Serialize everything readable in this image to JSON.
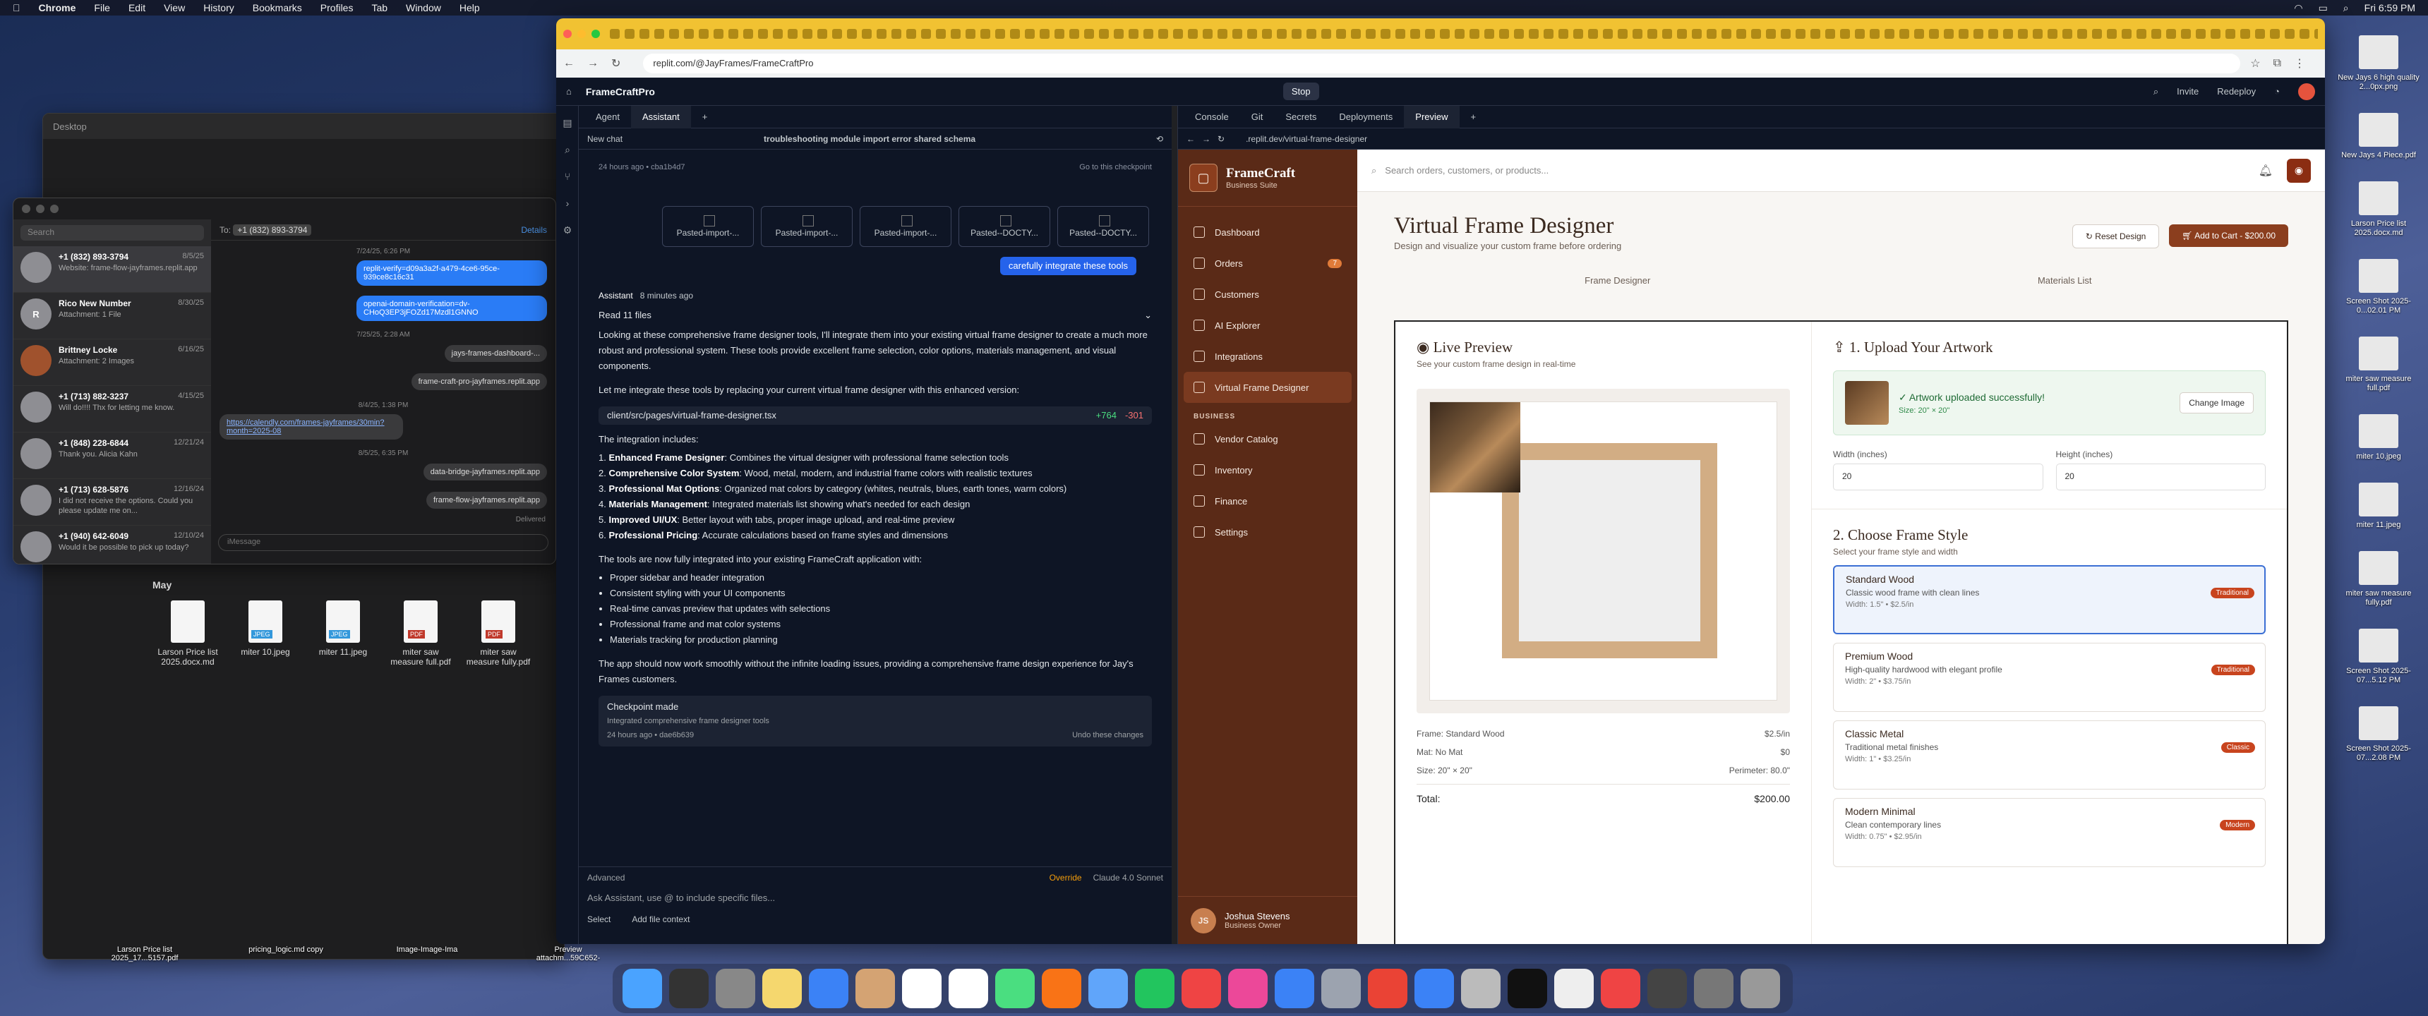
{
  "menubar": {
    "apple": "",
    "app": "Chrome",
    "items": [
      "File",
      "Edit",
      "View",
      "History",
      "Bookmarks",
      "Profiles",
      "Tab",
      "Window",
      "Help"
    ],
    "clock": "Fri 6:59 PM"
  },
  "finder": {
    "title": "Desktop",
    "month": "May",
    "files": [
      {
        "name": "Larson Price list 2025.docx.md",
        "type": "doc"
      },
      {
        "name": "miter 10.jpeg",
        "type": "jpg"
      },
      {
        "name": "miter 11.jpeg",
        "type": "jpg"
      },
      {
        "name": "miter saw measure full.pdf",
        "type": "pdf"
      },
      {
        "name": "miter saw measure fully.pdf",
        "type": "pdf"
      }
    ]
  },
  "messages": {
    "search_placeholder": "Search",
    "to_label": "To:",
    "to_value": "+1 (832) 893-3794",
    "details": "Details",
    "conversations": [
      {
        "name": "+1 (832) 893-3794",
        "date": "8/5/25",
        "preview": "Website: frame-flow-jayframes.replit.app",
        "initial": ""
      },
      {
        "name": "Rico New Number",
        "date": "8/30/25",
        "preview": "Attachment: 1 File",
        "initial": "R"
      },
      {
        "name": "Brittney Locke",
        "date": "6/16/25",
        "preview": "Attachment: 2 Images",
        "initial": ""
      },
      {
        "name": "+1 (713) 882-3237",
        "date": "4/15/25",
        "preview": "Will do!!!! Thx for letting me know.",
        "initial": ""
      },
      {
        "name": "+1 (848) 228-6844",
        "date": "12/21/24",
        "preview": "Thank you. Alicia Kahn",
        "initial": ""
      },
      {
        "name": "+1 (713) 628-5876",
        "date": "12/16/24",
        "preview": "I did not receive the options. Could you please update me on...",
        "initial": ""
      },
      {
        "name": "+1 (940) 642-6049",
        "date": "12/10/24",
        "preview": "Would it be possible to pick up today?",
        "initial": ""
      }
    ],
    "thread": {
      "ts1": "7/24/25, 6:26 PM",
      "b1": "replit-verify=d09a3a2f-a479-4ce6-95ce-939ce8c16c31",
      "b2": "openai-domain-verification=dv-CHoQ3EP3jFOZd17Mzdl1GNNO",
      "ts2": "7/25/25, 2:28 AM",
      "b3": "jays-frames-dashboard-...",
      "b4": "frame-craft-pro-jayframes.replit.app",
      "ts3": "8/4/25, 1:38 PM",
      "b5": "https://calendly.com/frames-jayframes/30min?month=2025-08",
      "ts4": "8/5/25, 6:35 PM",
      "b6": "data-bridge-jayframes.replit.app",
      "b7": "frame-flow-jayframes.replit.app",
      "delivered": "Delivered",
      "input_placeholder": "iMessage"
    }
  },
  "browser": {
    "url": "replit.com/@JayFrames/FrameCraftPro"
  },
  "replit": {
    "project": "FrameCraftPro",
    "stop": "Stop",
    "invite": "Invite",
    "redeploy": "Redeploy",
    "left_tabs": [
      "Agent",
      "Assistant"
    ],
    "right_tabs": [
      "Console",
      "Git",
      "Secrets",
      "Deployments",
      "Preview"
    ],
    "new_chat": "New chat",
    "chat_title": "troubleshooting module import error shared schema",
    "checkpoint_meta": "24 hours ago  •  cba1b4d7",
    "go_checkpoint": "Go to this checkpoint",
    "attachments": [
      "Pasted-import-...",
      "Pasted-import-...",
      "Pasted-import-...",
      "Pasted--DOCTY...",
      "Pasted--DOCTY..."
    ],
    "user_message": "carefully integrate these tools",
    "assistant_name": "Assistant",
    "assistant_time": "8 minutes ago",
    "read_files": "Read 11 files",
    "p1": "Looking at these comprehensive frame designer tools, I'll integrate them into your existing virtual frame designer to create a much more robust and professional system. These tools provide excellent frame selection, color options, materials management, and visual components.",
    "p2": "Let me integrate these tools by replacing your current virtual frame designer with this enhanced version:",
    "file_path": "client/src/pages/virtual-frame-designer.tsx",
    "file_add": "+764",
    "file_del": "-301",
    "p3": "The integration includes:",
    "integration": [
      {
        "n": "1.",
        "b": "Enhanced Frame Designer",
        "t": ": Combines the virtual designer with professional frame selection tools"
      },
      {
        "n": "2.",
        "b": "Comprehensive Color System",
        "t": ": Wood, metal, modern, and industrial frame colors with realistic textures"
      },
      {
        "n": "3.",
        "b": "Professional Mat Options",
        "t": ": Organized mat colors by category (whites, neutrals, blues, earth tones, warm colors)"
      },
      {
        "n": "4.",
        "b": "Materials Management",
        "t": ": Integrated materials list showing what's needed for each design"
      },
      {
        "n": "5.",
        "b": "Improved UI/UX",
        "t": ": Better layout with tabs, proper image upload, and real-time preview"
      },
      {
        "n": "6.",
        "b": "Professional Pricing",
        "t": ": Accurate calculations based on frame styles and dimensions"
      }
    ],
    "p4": "The tools are now fully integrated into your existing FrameCraft application with:",
    "features": [
      "Proper sidebar and header integration",
      "Consistent styling with your UI components",
      "Real-time canvas preview that updates with selections",
      "Professional frame and mat color systems",
      "Materials tracking for production planning"
    ],
    "p5": "The app should now work smoothly without the infinite loading issues, providing a comprehensive frame design experience for Jay's Frames customers.",
    "checkpoint_title": "Checkpoint made",
    "checkpoint_desc": "Integrated comprehensive frame designer tools",
    "checkpoint_meta2": "24 hours ago  •  dae6b639",
    "undo": "Undo these changes",
    "advanced": "Advanced",
    "override": "Override",
    "model": "Claude 4.0 Sonnet",
    "ask_placeholder": "Ask Assistant, use @ to include specific files...",
    "select": "Select",
    "add_context": "Add file context",
    "preview_url": ".replit.dev/virtual-frame-designer"
  },
  "app": {
    "brand": "FrameCraft",
    "brand_sub": "Business Suite",
    "search_placeholder": "Search orders, customers, or products...",
    "nav": [
      {
        "label": "Dashboard"
      },
      {
        "label": "Orders",
        "badge": "7"
      },
      {
        "label": "Customers"
      },
      {
        "label": "AI Explorer"
      },
      {
        "label": "Integrations"
      },
      {
        "label": "Virtual Frame Designer"
      }
    ],
    "business_label": "BUSINESS",
    "business_nav": [
      "Vendor Catalog",
      "Inventory",
      "Finance",
      "Settings"
    ],
    "user_initials": "JS",
    "user_name": "Joshua Stevens",
    "user_role": "Business Owner",
    "page_title": "Virtual Frame Designer",
    "page_sub": "Design and visualize your custom frame before ordering",
    "reset": "Reset Design",
    "add_cart": "Add to Cart - $200.00",
    "tabs": [
      "Frame Designer",
      "Materials List"
    ],
    "preview_title": "Live Preview",
    "preview_sub": "See your custom frame design in real-time",
    "specs": {
      "frame_label": "Frame: Standard Wood",
      "frame_price": "$2.5/in",
      "mat_label": "Mat: No Mat",
      "mat_price": "$0",
      "size_label": "Size: 20\" × 20\"",
      "perimeter": "Perimeter: 80.0\"",
      "total_label": "Total:",
      "total": "$200.00"
    },
    "upload_title": "1. Upload Your Artwork",
    "upload_ok": "✓ Artwork uploaded successfully!",
    "upload_size": "Size: 20\" × 20\"",
    "change_image": "Change Image",
    "width_label": "Width (inches)",
    "width_value": "20",
    "height_label": "Height (inches)",
    "height_value": "20",
    "style_title": "2. Choose Frame Style",
    "style_sub": "Select your frame style and width",
    "styles": [
      {
        "name": "Standard Wood",
        "desc": "Classic wood frame with clean lines",
        "width": "Width: 1.5\" • $2.5/in",
        "tag": "Traditional"
      },
      {
        "name": "Premium Wood",
        "desc": "High-quality hardwood with elegant profile",
        "width": "Width: 2\" • $3.75/in",
        "tag": "Traditional"
      },
      {
        "name": "Classic Metal",
        "desc": "Traditional metal finishes",
        "width": "Width: 1\" • $3.25/in",
        "tag": "Classic"
      },
      {
        "name": "Modern Minimal",
        "desc": "Clean contemporary lines",
        "width": "Width: 0.75\" • $2.95/in",
        "tag": "Modern"
      }
    ]
  },
  "desktop": {
    "right_icons": [
      "New Jays 6 high quality 2...0px.png",
      "New Jays 4 Piece.pdf",
      "Larson Price list 2025.docx.md",
      "Screen Shot 2025-0...02.01 PM",
      "miter saw measure full.pdf",
      "miter 10.jpeg",
      "miter 11.jpeg",
      "miter saw measure fully.pdf",
      "Screen Shot 2025-07...5.12 PM",
      "Screen Shot 2025-07...2.08 PM"
    ],
    "bottom_icons": [
      "Larson Price list 2025_17...5157.pdf",
      "pricing_logic.md copy",
      "Image-Image-Ima",
      "Preview attachm...59C652-"
    ]
  },
  "colors": {
    "sidebar": "#5a2a17",
    "accent": "#8b3e1e",
    "replit_bg": "#0e1525",
    "selected_style": "#3b6fd4",
    "tab_strip": "#f1c232"
  }
}
